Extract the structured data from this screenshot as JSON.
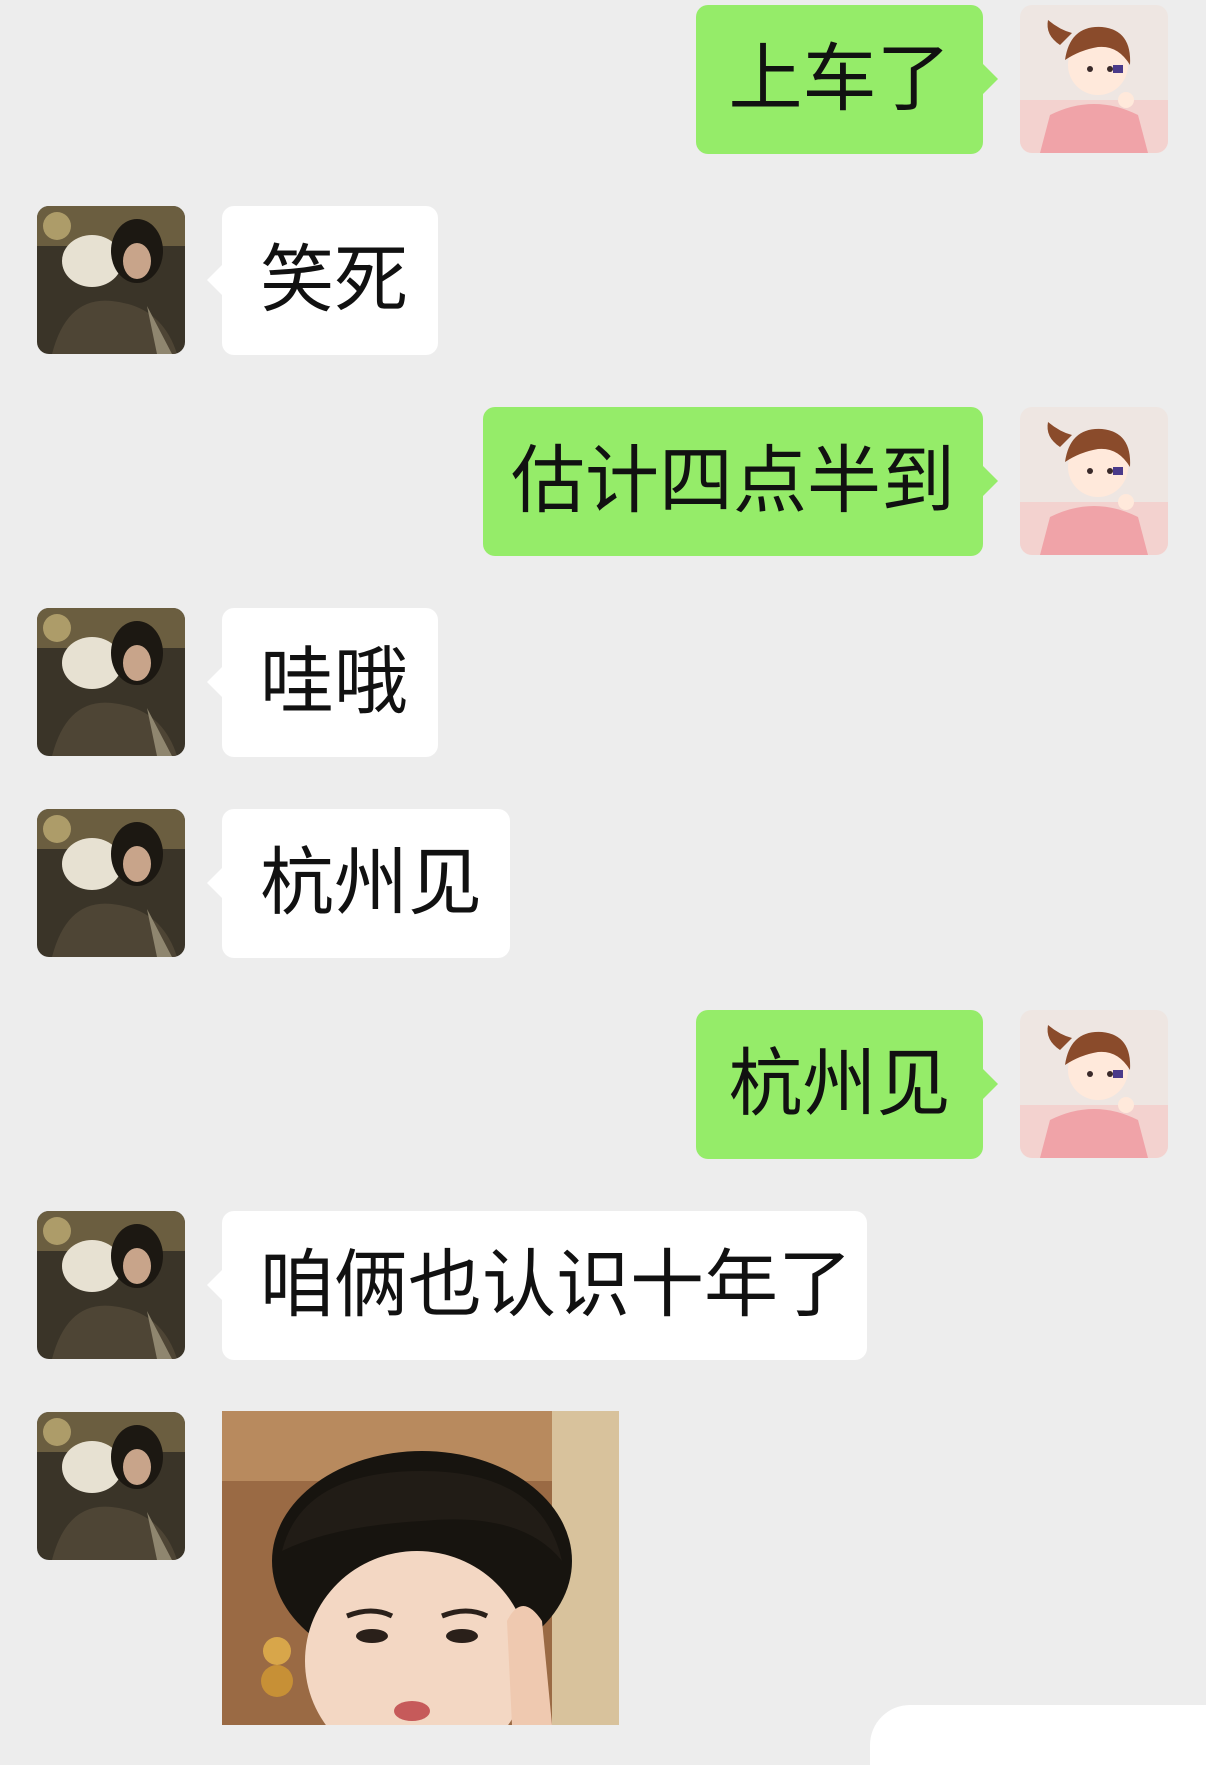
{
  "messages": [
    {
      "side": "right",
      "text": "上车了"
    },
    {
      "side": "left",
      "text": "笑死"
    },
    {
      "side": "right",
      "text": "估计四点半到"
    },
    {
      "side": "left",
      "text": "哇哦"
    },
    {
      "side": "left",
      "text": "杭州见"
    },
    {
      "side": "right",
      "text": "杭州见"
    },
    {
      "side": "left",
      "text": "咱俩也认识十年了"
    },
    {
      "side": "left",
      "type": "sticker",
      "icon": "reaction-sticker-image"
    }
  ],
  "colors": {
    "background": "#ededed",
    "outgoing_bubble": "#95ec69",
    "incoming_bubble": "#ffffff"
  },
  "avatars": {
    "self": "anime-girl-avatar-icon",
    "contact": "photo-avatar-icon"
  }
}
